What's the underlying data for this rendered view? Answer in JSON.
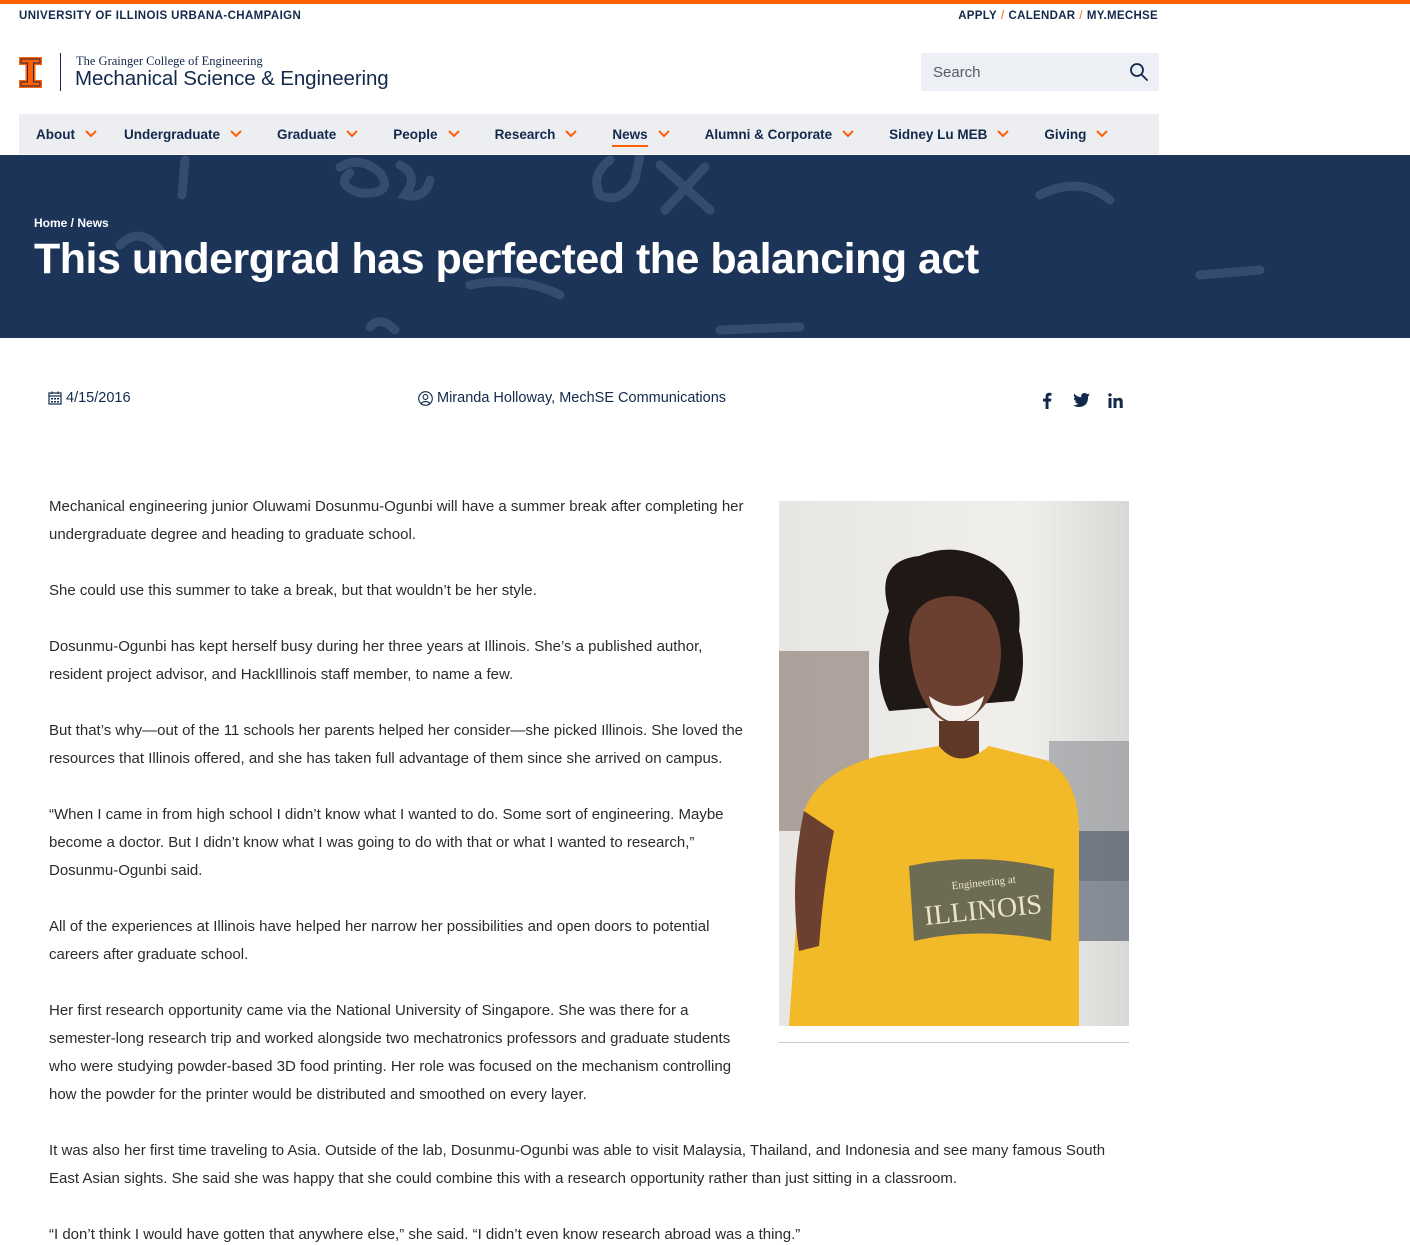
{
  "utility": {
    "university": "UNIVERSITY OF ILLINOIS URBANA-CHAMPAIGN",
    "links": [
      "APPLY",
      "CALENDAR",
      "MY.MECHSE"
    ],
    "separator": "/"
  },
  "brand": {
    "college": "The Grainger College of Engineering",
    "department": "Mechanical Science & Engineering",
    "logo_icon": "block-i-logo"
  },
  "search": {
    "placeholder": "Search",
    "icon": "search-icon"
  },
  "nav": {
    "items": [
      {
        "label": "About",
        "active": false
      },
      {
        "label": "Undergraduate",
        "active": false
      },
      {
        "label": "Graduate",
        "active": false
      },
      {
        "label": "People",
        "active": false
      },
      {
        "label": "Research",
        "active": false
      },
      {
        "label": "News",
        "active": true
      },
      {
        "label": "Alumni & Corporate",
        "active": false
      },
      {
        "label": "Sidney Lu MEB",
        "active": false
      },
      {
        "label": "Giving",
        "active": false
      }
    ]
  },
  "breadcrumb": {
    "home": "Home",
    "separator": " / ",
    "current": "News"
  },
  "article": {
    "title": "This undergrad has perfected the balancing act",
    "date": "4/15/2016",
    "author": "Miranda Holloway, MechSE Communications",
    "paragraphs": [
      "Mechanical engineering junior Oluwami Dosunmu-Ogunbi will have a summer break after completing her undergraduate degree and heading to graduate school.",
      "She could use this summer to take a break, but that wouldn’t be her style.",
      "Dosunmu-Ogunbi has kept herself busy during her three years at Illinois. She’s a published author, resident project advisor, and HackIllinois staff member, to name a few.",
      "But that’s why—out of the 11 schools her parents helped her consider—she picked Illinois. She loved the resources that Illinois offered, and she has taken full advantage of them since she arrived on campus.",
      "“When I came in from high school I didn’t know what I wanted to do. Some sort of engineering. Maybe become a doctor. But I didn’t know what I was going to do with that or what I wanted to research,” Dosunmu-Ogunbi said.",
      "All of the experiences at Illinois have helped her narrow her possibilities and open doors to potential careers after graduate school.",
      "Her first research opportunity came via the National University of Singapore. She was there for a semester-long research trip and worked alongside two mechatronics professors and graduate students who were studying powder-based 3D food printing. Her role was focused on the mechanism controlling how the powder for the printer would be distributed and smoothed on every layer.",
      "It was also her first time traveling to Asia. Outside of the lab, Dosunmu-Ogunbi was able to visit Malaysia, Thailand, and Indonesia and see many famous South East Asian sights. She said she was happy that she could combine this with a research opportunity rather than just sitting in a classroom.",
      "“I don’t think I would have gotten that anywhere else,” she said. “I didn’t even know research abroad was a thing.”"
    ],
    "photo_shirt_text_small": "Engineering at",
    "photo_shirt_text_large": "ILLINOIS"
  },
  "social": [
    "facebook-icon",
    "twitter-icon",
    "linkedin-icon"
  ],
  "colors": {
    "orange": "#ff5f05",
    "navy": "#13294b",
    "hero": "#1d3459",
    "nav_bg": "#eceef1"
  }
}
